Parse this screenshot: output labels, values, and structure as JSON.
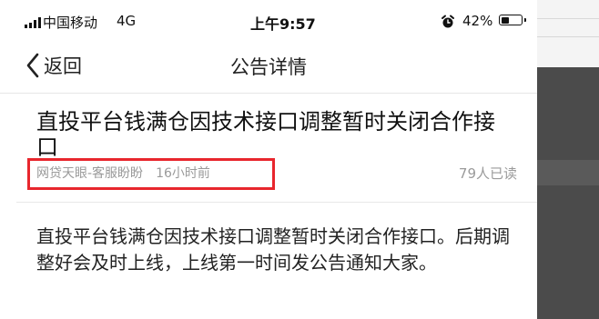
{
  "status_bar": {
    "carrier": "中国移动",
    "network": "4G",
    "time": "上午9:57",
    "battery_percent": "42%",
    "battery_level": 0.42,
    "icons": [
      "signal-icon",
      "alarm-icon",
      "battery-icon"
    ]
  },
  "nav": {
    "back_label": "返回",
    "title": "公告详情"
  },
  "article": {
    "title": "直投平台钱满仓因技术接口调整暂时关闭合作接口",
    "author": "网贷天眼-客服盼盼",
    "time_ago": "16小时前",
    "read_count": "79人已读",
    "body": "直投平台钱满仓因技术接口调整暂时关闭合作接口。后期调整好会及时上线，上线第一时间发公告通知大家。"
  },
  "colors": {
    "highlight_box": "#e8262d",
    "meta_text": "#9a9a9a",
    "side_panel": "#4b4b4b"
  }
}
